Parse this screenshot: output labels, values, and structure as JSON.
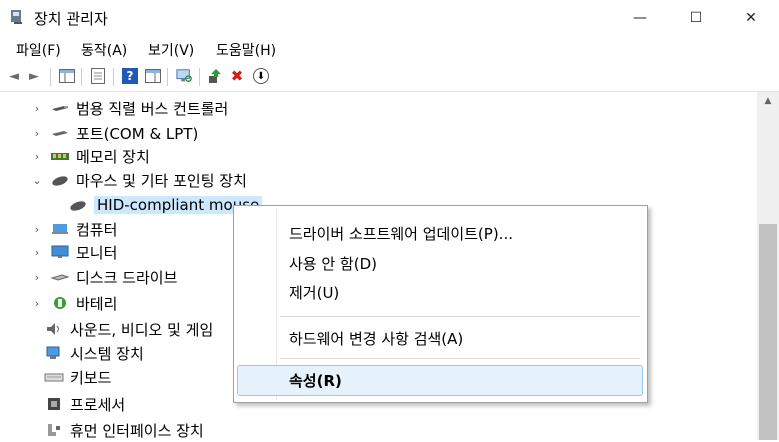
{
  "window": {
    "title": "장치 관리자",
    "minimize": "—",
    "maximize": "☐",
    "close": "✕"
  },
  "menu": [
    "파일(F)",
    "동작(A)",
    "보기(V)",
    "도움말(H)"
  ],
  "toolbar": {
    "back": "◄",
    "forward": "►",
    "help": "?",
    "remove": "✖",
    "down": "⬇"
  },
  "tree": [
    {
      "label": "범용 직렬 버스 컨트롤러",
      "chevron": "›"
    },
    {
      "label": "포트(COM & LPT)",
      "chevron": "›"
    },
    {
      "label": "메모리 장치",
      "chevron": "›"
    },
    {
      "label": "마우스 및 기타 포인팅 장치",
      "chevron": "⌄"
    },
    {
      "label": "HID-compliant mouse",
      "chevron": ""
    },
    {
      "label": "컴퓨터",
      "chevron": "›"
    },
    {
      "label": "모니터",
      "chevron": "›"
    },
    {
      "label": "디스크 드라이브",
      "chevron": "›"
    },
    {
      "label": "바테리",
      "chevron": "›"
    },
    {
      "label": "사운드, 비디오 및 게임",
      "chevron": ""
    },
    {
      "label": "시스템 장치",
      "chevron": ""
    },
    {
      "label": "키보드",
      "chevron": ""
    },
    {
      "label": "프로세서",
      "chevron": ""
    },
    {
      "label": "휴먼 인터페이스 장치",
      "chevron": ""
    }
  ],
  "context_menu": {
    "update_driver": "드라이버 소프트웨어 업데이트(P)...",
    "disable": "사용 안 함(D)",
    "uninstall": "제거(U)",
    "scan": "하드웨어 변경 사항 검색(A)",
    "properties": "속성(R)"
  },
  "colors": {
    "selection": "#cce8ff",
    "hover": "#e5f1fb",
    "hover_border": "#99c9ef"
  }
}
